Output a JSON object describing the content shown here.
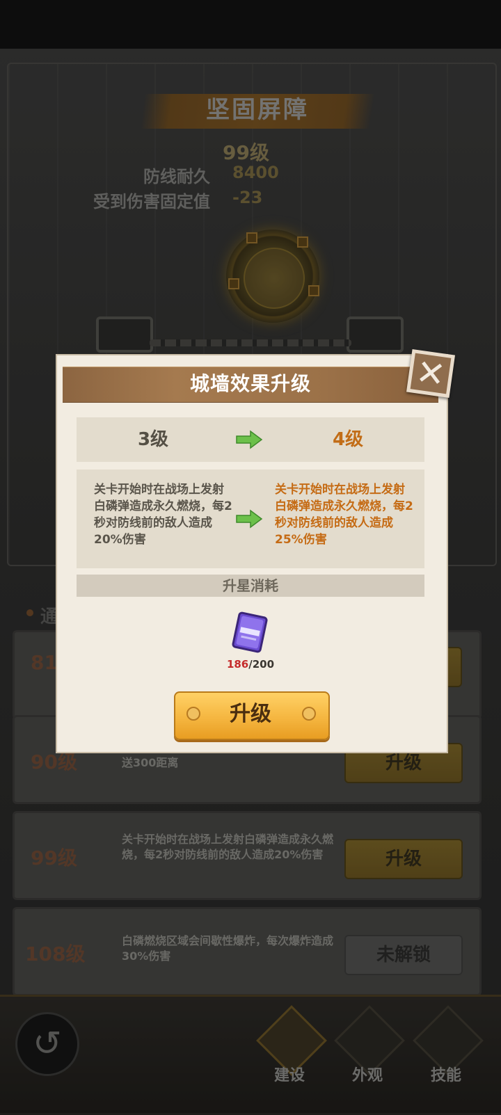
{
  "background": {
    "title": "坚固屏障",
    "level": "99级",
    "stats": [
      {
        "label": "防线耐久",
        "value": "8400"
      },
      {
        "label": "受到伤害固定值",
        "value": "-23"
      }
    ],
    "section_char": "通",
    "cards": [
      {
        "level": "81",
        "desc": "",
        "button": ""
      },
      {
        "level": "90级",
        "desc": "攻击防线的怪物，有6%的概率会被向后传送300距离",
        "button": "升级"
      },
      {
        "level": "99级",
        "desc": "关卡开始时在战场上发射白磷弹造成永久燃烧，每2秒对防线前的敌人造成20%伤害",
        "button": "升级"
      },
      {
        "level": "108级",
        "desc": "白磷燃烧区域会间歇性爆炸，每次爆炸造成30%伤害",
        "button": "未解锁"
      }
    ]
  },
  "bottom_nav": {
    "tabs": [
      {
        "label": "建设",
        "icon": "building-icon"
      },
      {
        "label": "外观",
        "icon": "wall-icon"
      },
      {
        "label": "技能",
        "icon": "skill-icon"
      }
    ]
  },
  "modal": {
    "title": "城墙效果升级",
    "from_level": "3级",
    "to_level": "4级",
    "desc_old": "关卡开始时在战场上发射白磷弹造成永久燃烧，每2秒对防线前的敌人造成20%伤害",
    "desc_new": "关卡开始时在战场上发射白磷弹造成永久燃烧，每2秒对防线前的敌人造成25%伤害",
    "cost_title": "升星消耗",
    "item": {
      "have": "186",
      "need": "/200",
      "icon": "purple-scroll-icon"
    },
    "upgrade_label": "升级"
  },
  "colors": {
    "accent": "#f5b640",
    "new_value": "#c26d17",
    "insufficient": "#c52b2b",
    "arrow": "#6cc04a"
  }
}
